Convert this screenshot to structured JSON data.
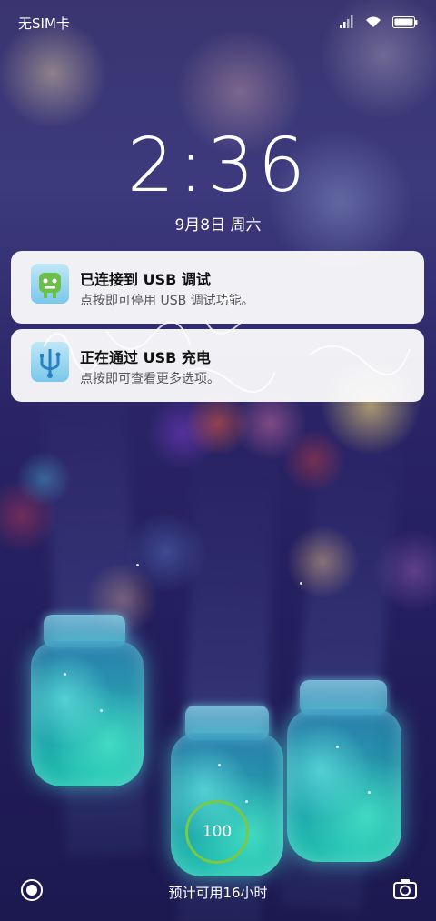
{
  "statusbar": {
    "carrier": "无SIM卡",
    "icons": [
      "signal-icon",
      "wifi-icon",
      "battery-icon"
    ]
  },
  "lockscreen": {
    "time": "2:36",
    "date": "9月8日  周六"
  },
  "notifications": [
    {
      "icon": "usb-debug-icon",
      "title": "已连接到 USB 调试",
      "text": "点按即可停用 USB 调试功能。"
    },
    {
      "icon": "usb-charge-icon",
      "title": "正在通过 USB 充电",
      "text": "点按即可查看更多选项。"
    }
  ],
  "battery": {
    "level": "100",
    "estimate": "预计可用16小时",
    "ring_color": "#7ac943"
  },
  "bottom_bar": {
    "left_icon": "control-center-icon",
    "right_icon": "camera-icon"
  }
}
